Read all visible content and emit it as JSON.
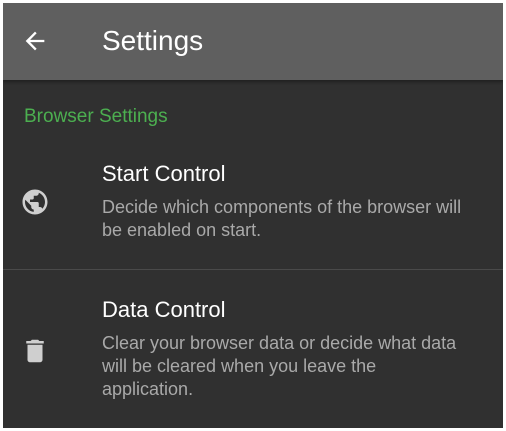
{
  "toolbar": {
    "back_icon": "arrow-back-icon",
    "title": "Settings",
    "background": "#5f5f5f"
  },
  "section": {
    "header": "Browser Settings",
    "accent_color": "#4caf50"
  },
  "preferences": [
    {
      "icon": "globe-icon",
      "title": "Start Control",
      "summary": "Decide which components of the browser will be enabled on start."
    },
    {
      "icon": "trash-icon",
      "title": "Data Control",
      "summary": "Clear your browser data or decide what data will be cleared when you leave the application."
    }
  ],
  "theme": {
    "background": "#303030",
    "title_text": "#ffffff",
    "summary_text": "#a9a9a9",
    "icon_color": "#cfcfcf"
  }
}
